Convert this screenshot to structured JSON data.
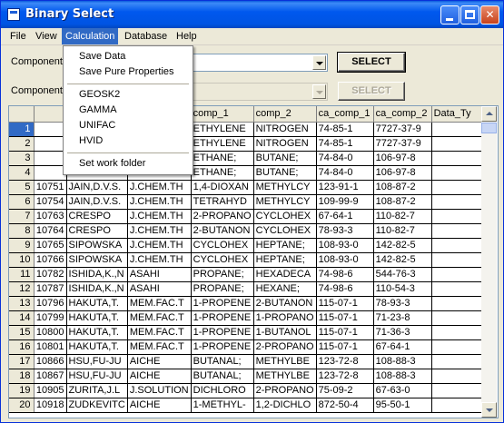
{
  "window": {
    "title": "Binary Select"
  },
  "menubar": {
    "items": [
      {
        "label": "File"
      },
      {
        "label": "View"
      },
      {
        "label": "Calculation",
        "active": true
      },
      {
        "label": "Database"
      },
      {
        "label": "Help"
      }
    ]
  },
  "form": {
    "component1_label": "Component",
    "component2_label": "Component",
    "select_label": "SELECT",
    "select2_label": "SELECT"
  },
  "calc_menu": {
    "group1": [
      {
        "label": "Save Data"
      },
      {
        "label": "Save Pure Properties"
      }
    ],
    "group2": [
      {
        "label": "GEOSK2"
      },
      {
        "label": "GAMMA"
      },
      {
        "label": "UNIFAC"
      },
      {
        "label": "HVID"
      }
    ],
    "group3": [
      {
        "label": "Set work folder"
      }
    ]
  },
  "grid": {
    "headers": [
      "",
      "",
      "",
      "",
      "comp_1",
      "comp_2",
      "ca_comp_1",
      "ca_comp_2",
      "Data_Ty"
    ],
    "rows": [
      [
        "1",
        "",
        "",
        "",
        "ETHYLENE",
        "NITROGEN",
        "74-85-1",
        "7727-37-9",
        ""
      ],
      [
        "2",
        "",
        "",
        "",
        "ETHYLENE",
        "NITROGEN",
        "74-85-1",
        "7727-37-9",
        ""
      ],
      [
        "3",
        "",
        "",
        "",
        "ETHANE;",
        "BUTANE;",
        "74-84-0",
        "106-97-8",
        ""
      ],
      [
        "4",
        "",
        "",
        "",
        "ETHANE;",
        "BUTANE;",
        "74-84-0",
        "106-97-8",
        ""
      ],
      [
        "5",
        "10751",
        "JAIN,D.V.S.",
        "J.CHEM.TH",
        "1,4-DIOXAN",
        "METHYLCY",
        "123-91-1",
        "108-87-2",
        ""
      ],
      [
        "6",
        "10754",
        "JAIN,D.V.S.",
        "J.CHEM.TH",
        "TETRAHYD",
        "METHYLCY",
        "109-99-9",
        "108-87-2",
        ""
      ],
      [
        "7",
        "10763",
        "CRESPO",
        "J.CHEM.TH",
        "2-PROPANO",
        "CYCLOHEX",
        "67-64-1",
        "110-82-7",
        ""
      ],
      [
        "8",
        "10764",
        "CRESPO",
        "J.CHEM.TH",
        "2-BUTANON",
        "CYCLOHEX",
        "78-93-3",
        "110-82-7",
        ""
      ],
      [
        "9",
        "10765",
        "SIPOWSKA",
        "J.CHEM.TH",
        "CYCLOHEX",
        "HEPTANE;",
        "108-93-0",
        "142-82-5",
        ""
      ],
      [
        "10",
        "10766",
        "SIPOWSKA",
        "J.CHEM.TH",
        "CYCLOHEX",
        "HEPTANE;",
        "108-93-0",
        "142-82-5",
        ""
      ],
      [
        "11",
        "10782",
        "ISHIDA,K.,N",
        "ASAHI",
        "PROPANE;",
        "HEXADECA",
        "74-98-6",
        "544-76-3",
        ""
      ],
      [
        "12",
        "10787",
        "ISHIDA,K.,N",
        "ASAHI",
        "PROPANE;",
        "HEXANE;",
        "74-98-6",
        "110-54-3",
        ""
      ],
      [
        "13",
        "10796",
        "HAKUTA,T.",
        "MEM.FAC.T",
        "1-PROPENE",
        "2-BUTANON",
        "115-07-1",
        "78-93-3",
        ""
      ],
      [
        "14",
        "10799",
        "HAKUTA,T.",
        "MEM.FAC.T",
        "1-PROPENE",
        "1-PROPANO",
        "115-07-1",
        "71-23-8",
        ""
      ],
      [
        "15",
        "10800",
        "HAKUTA,T.",
        "MEM.FAC.T",
        "1-PROPENE",
        "1-BUTANOL",
        "115-07-1",
        "71-36-3",
        ""
      ],
      [
        "16",
        "10801",
        "HAKUTA,T.",
        "MEM.FAC.T",
        "1-PROPENE",
        "2-PROPANO",
        "115-07-1",
        "67-64-1",
        ""
      ],
      [
        "17",
        "10866",
        "HSU,FU-JU",
        "AICHE",
        "BUTANAL;",
        "METHYLBE",
        "123-72-8",
        "108-88-3",
        ""
      ],
      [
        "18",
        "10867",
        "HSU,FU-JU",
        "AICHE",
        "BUTANAL;",
        "METHYLBE",
        "123-72-8",
        "108-88-3",
        ""
      ],
      [
        "19",
        "10905",
        "ZURITA,J.L",
        "J.SOLUTION",
        "DICHLORO",
        "2-PROPANO",
        "75-09-2",
        "67-63-0",
        ""
      ],
      [
        "20",
        "10918",
        "ZUDKEVITC",
        "AICHE",
        "1-METHYL-",
        "1,2-DICHLO",
        "872-50-4",
        "95-50-1",
        ""
      ]
    ]
  },
  "colors": {
    "selection": "#316ac5",
    "titlebar": "#0054e3"
  }
}
